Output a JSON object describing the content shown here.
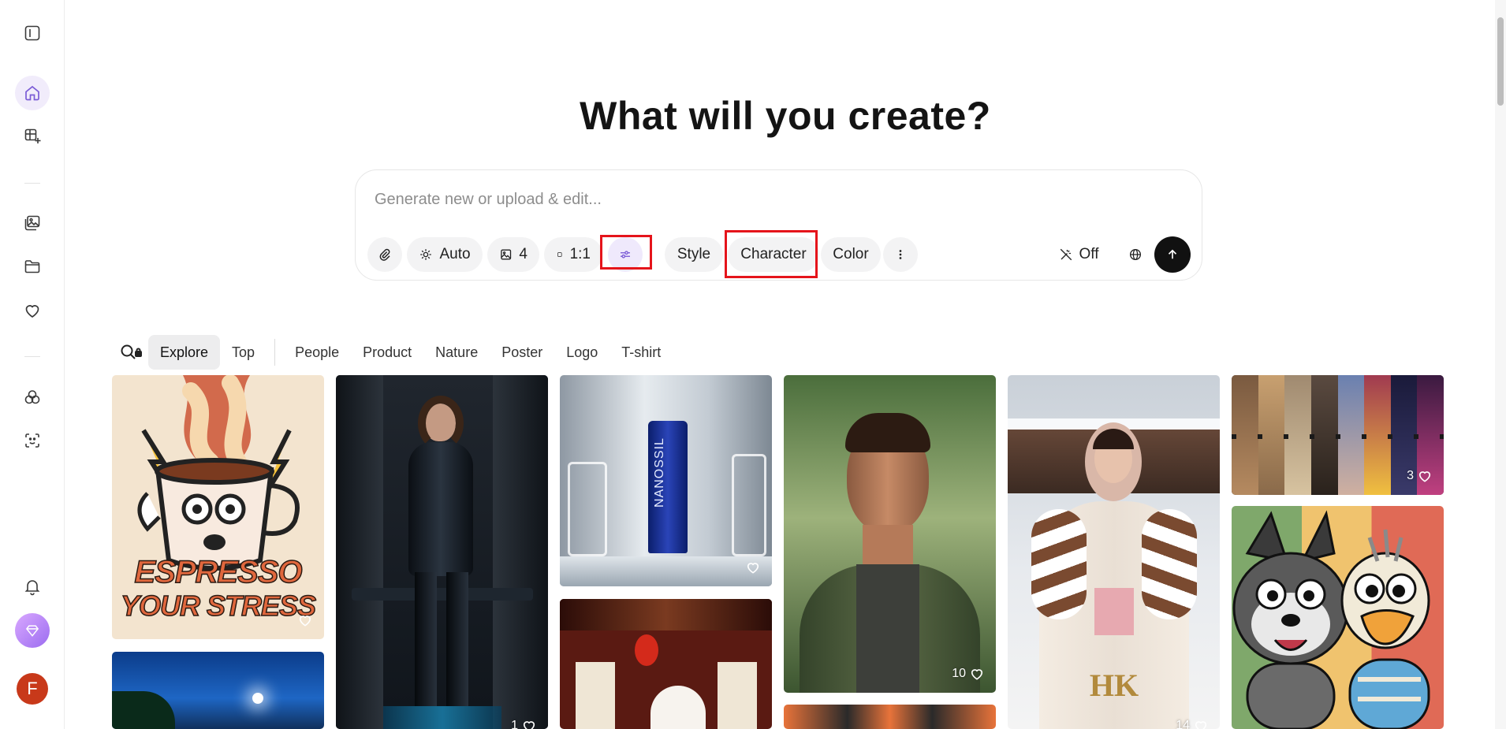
{
  "headline": "What will you create?",
  "prompt": {
    "placeholder": "Generate new or upload & edit...",
    "auto_label": "Auto",
    "count_label": "4",
    "ratio_label": "1:1",
    "style_label": "Style",
    "character_label": "Character",
    "color_label": "Color",
    "magic_label": "Off"
  },
  "tabs": [
    "Explore",
    "Top",
    "People",
    "Product",
    "Nature",
    "Poster",
    "Logo",
    "T-shirt"
  ],
  "gallery": {
    "espresso_line1": "ESPRESSO",
    "espresso_line2": "YOUR STRESS",
    "tube_brand": "NANOSSIL",
    "likes_smileys": "3",
    "likes_man": "10",
    "likes_kimono": "14",
    "likes_woman": "1",
    "kimono_mark": "HK"
  },
  "sidebar": {
    "avatar_letter": "F"
  },
  "colors": {
    "accent": "#7b5cd6",
    "highlight": "#e5141b",
    "avatar": "#c8391a"
  }
}
